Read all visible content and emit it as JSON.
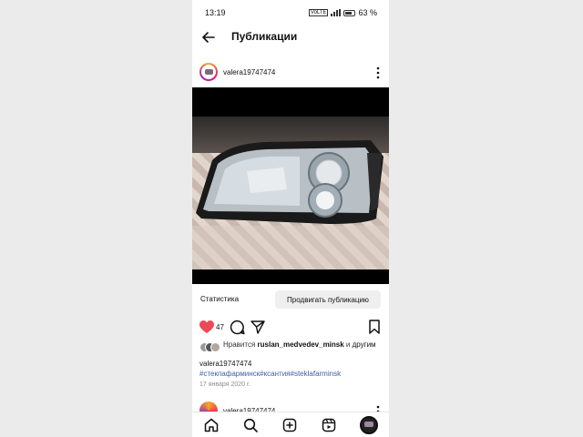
{
  "status_bar": {
    "time": "13:19",
    "battery_percent": "63 %",
    "network": "VoLTE"
  },
  "header": {
    "title": "Публикации",
    "back_icon": "arrow-left-icon"
  },
  "post": {
    "username": "valera19747474",
    "more_icon": "more-vertical-icon",
    "image_description_icon": "car-headlight-photo",
    "stats_label": "Статистика",
    "promote_label": "Продвигать публикацию",
    "like_count": "47",
    "liked": true,
    "liked_by_prefix": "Нравится ",
    "liked_by_user": "ruslan_medvedev_minsk",
    "liked_by_suffix": " и ",
    "liked_by_others": "другим",
    "caption_user": "valera19747474",
    "hashtags": "#стекпафарминск#ксантия#steklafarminsk",
    "date": "17 января 2020 г."
  },
  "next_post": {
    "username": "valera19747474"
  },
  "bottom_nav": {
    "items": [
      "home-icon",
      "search-icon",
      "create-icon",
      "reels-icon",
      "profile-avatar"
    ]
  },
  "colors": {
    "like_red": "#ed4956",
    "hashtag_blue": "#3d5ea8",
    "button_gray": "#efefef"
  }
}
